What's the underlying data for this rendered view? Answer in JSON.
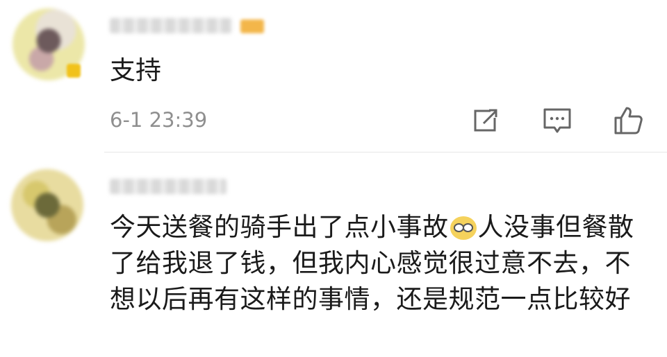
{
  "comments": [
    {
      "text": "支持",
      "time": "6-1 23:39"
    },
    {
      "text_a": "今天送餐的骑手出了点小事故",
      "emoji": "dizzy-face-emoji",
      "text_b": "人没事但餐散了给我退了钱，但我内心感觉很过意不去，不想以后再有这样的事情，还是规范一点比较好"
    }
  ],
  "icons": {
    "share": "share-icon",
    "reply": "comment-icon",
    "like": "thumbs-up-icon"
  },
  "colors": {
    "text": "#1a1a1a",
    "meta": "#8f8f8f",
    "icon": "#666666",
    "divider": "#e6e6e6"
  }
}
